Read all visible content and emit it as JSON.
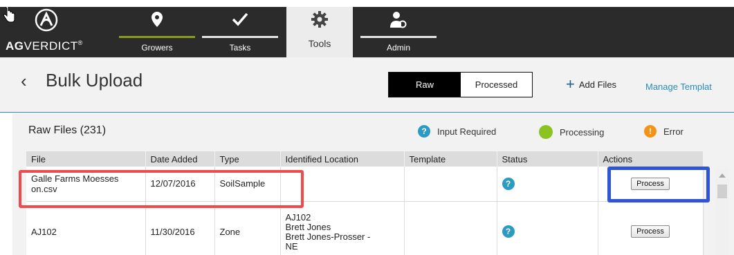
{
  "brand": {
    "name_bold": "AG",
    "name_rest": "VERDICT",
    "reg": "®"
  },
  "nav": {
    "tabs": [
      {
        "label": "Growers",
        "icon": "location-pin-icon"
      },
      {
        "label": "Tasks",
        "icon": "checkmark-icon"
      },
      {
        "label": "Tools",
        "icon": "gear-icon",
        "active": true
      },
      {
        "label": "Admin",
        "icon": "user-gear-icon"
      }
    ]
  },
  "page": {
    "back_glyph": "‹",
    "title": "Bulk Upload",
    "toggle": {
      "raw": "Raw",
      "processed": "Processed",
      "selected": "Raw"
    },
    "add_files": "Add Files",
    "manage_templates": "Manage Templat"
  },
  "list": {
    "heading": "Raw Files (231)",
    "legend": [
      {
        "label": "Input Required",
        "icon": "question-icon",
        "color": "#2b9bc3"
      },
      {
        "label": "Processing",
        "icon": "processing-dot-icon",
        "color": "#8bc320"
      },
      {
        "label": "Error",
        "icon": "error-icon",
        "color": "#f39419"
      }
    ],
    "columns": [
      "File",
      "Date Added",
      "Type",
      "Identified Location",
      "Template",
      "Status",
      "Actions"
    ],
    "rows": [
      {
        "file_line1": "Galle Farms Moesses",
        "file_line2": "on.csv",
        "date": "12/07/2016",
        "type": "SoilSample",
        "location": [],
        "template": "",
        "status": "input-required",
        "action": "Process"
      },
      {
        "file_line1": "AJ102",
        "file_line2": "",
        "date": "11/30/2016",
        "type": "Zone",
        "location": [
          "AJ102",
          "Brett Jones",
          "Brett Jones-Prosser -",
          "NE"
        ],
        "template": "",
        "status": "input-required",
        "action": "Process"
      }
    ]
  },
  "colors": {
    "topbar": "#2b2b2b",
    "accent_blue": "#2a8bb5",
    "growers_underline": "#8c9b1e",
    "highlight_red": "#ee4c4c",
    "highlight_blue": "#2f54d6"
  }
}
